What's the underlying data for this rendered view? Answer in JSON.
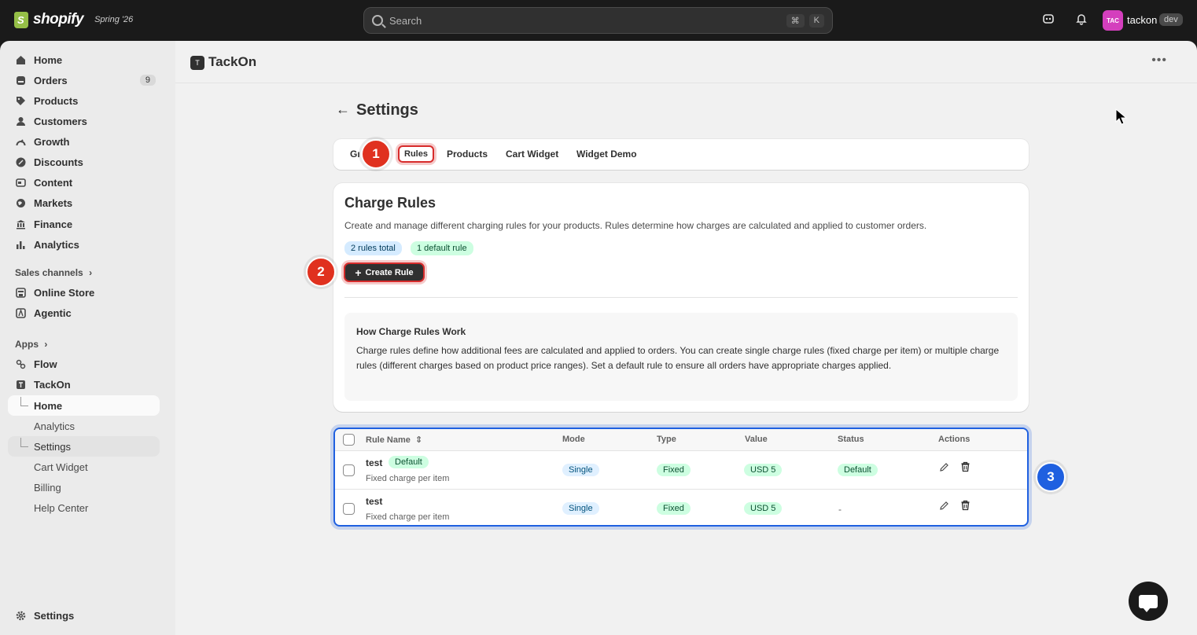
{
  "topbar": {
    "brand": "shopify",
    "edition": "Spring '26",
    "search_placeholder": "Search",
    "shortcut_keys": [
      "⌘",
      "K"
    ],
    "avatar_initials": "TAC",
    "user_name": "tackon",
    "env_badge": "dev"
  },
  "sidebar": {
    "items": [
      {
        "label": "Home",
        "icon": "home-icon"
      },
      {
        "label": "Orders",
        "icon": "orders-icon",
        "count": "9"
      },
      {
        "label": "Products",
        "icon": "tag-icon"
      },
      {
        "label": "Customers",
        "icon": "person-icon"
      },
      {
        "label": "Growth",
        "icon": "growth-icon"
      },
      {
        "label": "Discounts",
        "icon": "discount-icon"
      },
      {
        "label": "Content",
        "icon": "content-icon"
      },
      {
        "label": "Markets",
        "icon": "globe-icon"
      },
      {
        "label": "Finance",
        "icon": "bank-icon"
      },
      {
        "label": "Analytics",
        "icon": "bar-chart-icon"
      }
    ],
    "sales_channels_label": "Sales channels",
    "sales_channels": [
      {
        "label": "Online Store",
        "icon": "store-icon"
      },
      {
        "label": "Agentic",
        "icon": "agent-icon"
      }
    ],
    "apps_label": "Apps",
    "apps": [
      {
        "label": "Flow",
        "icon": "flow-icon"
      },
      {
        "label": "TackOn",
        "icon": "tackon-app-icon"
      }
    ],
    "app_subitems": [
      "Home",
      "Analytics",
      "Settings",
      "Cart Widget",
      "Billing",
      "Help Center"
    ],
    "settings_label": "Settings"
  },
  "app": {
    "title": "TackOn",
    "page_title": "Settings"
  },
  "tabs": {
    "general_truncated": "Gı",
    "rules": "Rules",
    "products": "Products",
    "cart_widget": "Cart Widget",
    "widget_demo": "Widget Demo"
  },
  "markers": {
    "m1": "1",
    "m2": "2",
    "m3": "3"
  },
  "charge_rules": {
    "title": "Charge Rules",
    "description": "Create and manage different charging rules for your products. Rules determine how charges are calculated and applied to customer orders.",
    "badge_total": "2 rules total",
    "badge_default": "1 default rule",
    "create_button": "Create Rule",
    "info_title": "How Charge Rules Work",
    "info_text": "Charge rules define how additional fees are calculated and applied to orders. You can create single charge rules (fixed charge per item) or multiple charge rules (different charges based on product price ranges). Set a default rule to ensure all orders have appropriate charges applied."
  },
  "table": {
    "headers": {
      "name": "Rule Name",
      "mode": "Mode",
      "type": "Type",
      "value": "Value",
      "status": "Status",
      "actions": "Actions"
    },
    "rows": [
      {
        "name": "test",
        "default_tag": "Default",
        "subtitle": "Fixed charge per item",
        "mode": "Single",
        "type": "Fixed",
        "value": "USD 5",
        "status": "Default"
      },
      {
        "name": "test",
        "subtitle": "Fixed charge per item",
        "mode": "Single",
        "type": "Fixed",
        "value": "USD 5",
        "status": "-"
      }
    ]
  }
}
